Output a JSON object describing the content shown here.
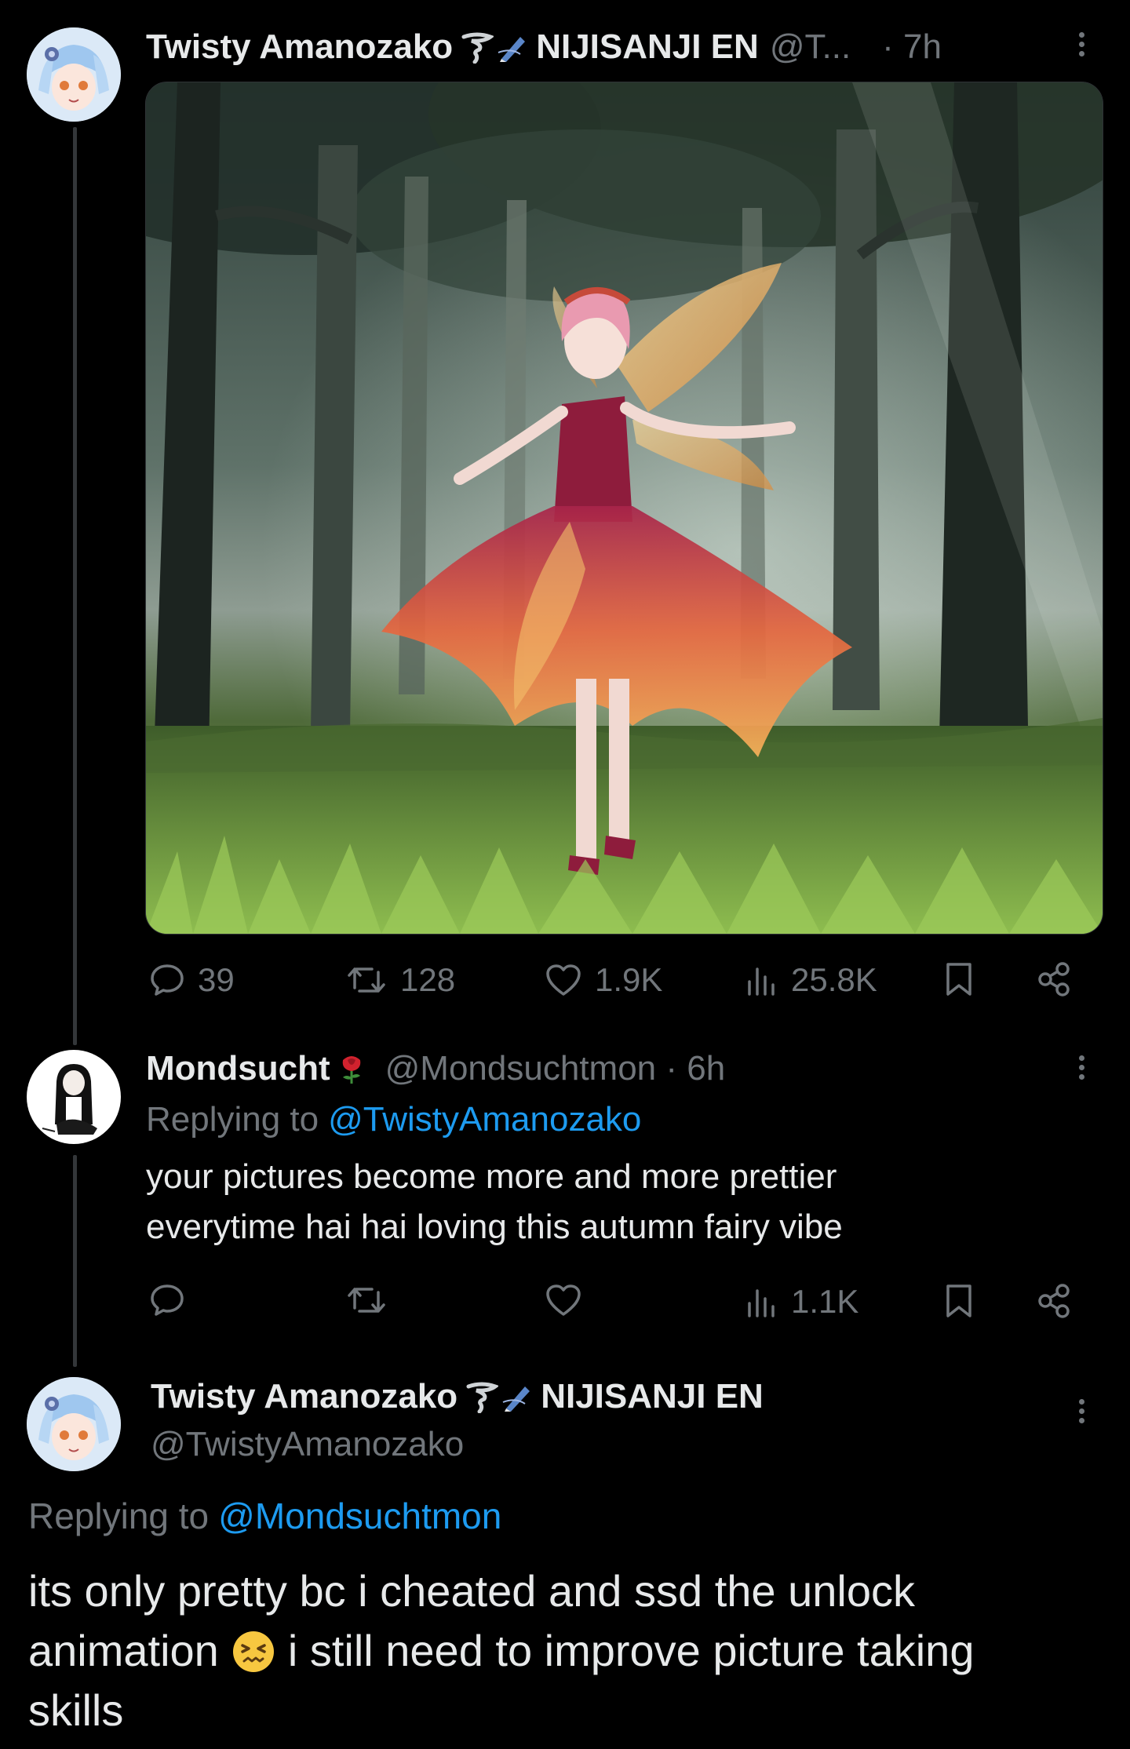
{
  "tweet1": {
    "display_name": "Twisty Amanozako",
    "affiliation": "NIJISANJI EN",
    "handle_truncated": "@T...",
    "time": "· 7h",
    "stats": {
      "replies": "39",
      "retweets": "128",
      "likes": "1.9K",
      "views": "25.8K"
    }
  },
  "reply1": {
    "display_name": "Mondsucht",
    "handle_time": "@Mondsuchtmon · 6h",
    "replying_prefix": "Replying to",
    "replying_to": "@TwistyAmanozako",
    "text": "your pictures become more and more prettier\neverytime hai hai loving this autumn fairy vibe",
    "stats": {
      "views": "1.1K"
    }
  },
  "reply2": {
    "display_name": "Twisty Amanozako",
    "affiliation": "NIJISANJI EN",
    "handle": "@TwistyAmanozako",
    "replying_prefix": "Replying to",
    "replying_to": "@Mondsuchtmon",
    "text_line1": "its only pretty bc i cheated and ssd the unlock",
    "text_line2_a": "animation",
    "text_line2_b": "i still need to improve picture taking",
    "text_line3": "skills"
  },
  "icons": {
    "tornado": "tornado-emoji-icon",
    "pen": "pen-emoji-icon",
    "rose": "rose-emoji-icon",
    "confounded": "confounded-face-emoji-icon"
  },
  "colors": {
    "background": "#000000",
    "text": "#e7e9ea",
    "muted": "#71767b",
    "link": "#1d9bf0"
  }
}
